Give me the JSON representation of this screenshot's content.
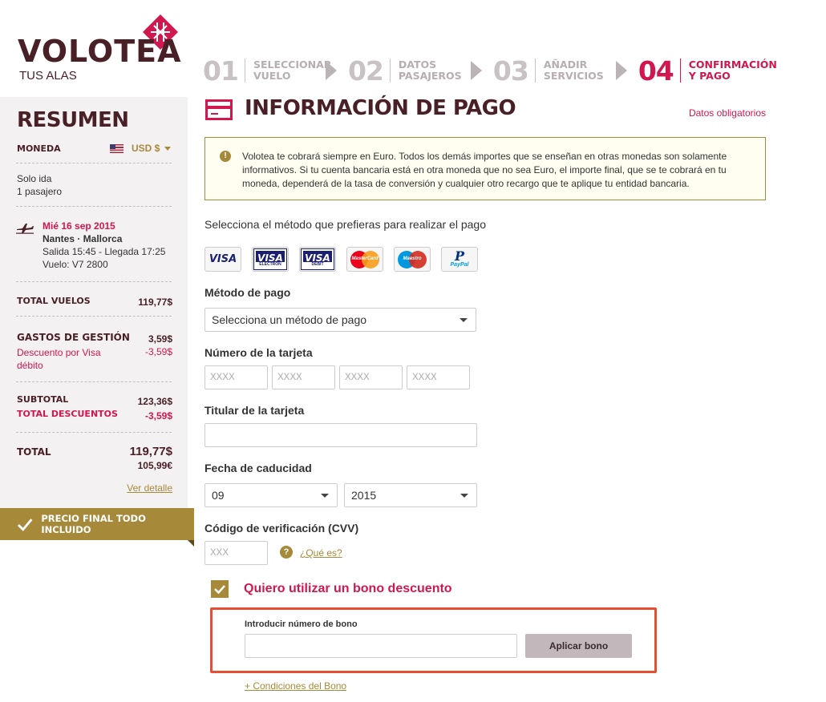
{
  "brand": {
    "name": "VOLOTEA",
    "tagline": "TUS ALAS"
  },
  "steps": [
    {
      "num": "01",
      "label": "SELECCIONAR VUELO",
      "active": false
    },
    {
      "num": "02",
      "label": "DATOS PASAJEROS",
      "active": false
    },
    {
      "num": "03",
      "label": "AÑADIR SERVICIOS",
      "active": false
    },
    {
      "num": "04",
      "label": "CONFIRMACIÓN Y PAGO",
      "active": true
    }
  ],
  "summary": {
    "title": "RESUMEN",
    "currency_label": "MONEDA",
    "currency_value": "USD $",
    "trip_type": "Solo ida",
    "passengers": "1 pasajero",
    "flight": {
      "date": "Mié 16 sep 2015",
      "route": "Nantes · Mallorca",
      "times": "Salida 15:45 - Llegada 17:25",
      "flight_no": "Vuelo: V7 2800"
    },
    "total_flights_label": "TOTAL VUELOS",
    "total_flights_value": "119,77$",
    "fees_label": "GASTOS DE GESTIÓN",
    "fees_value": "3,59$",
    "discount_label": "Descuento por Visa débito",
    "discount_value": "-3,59$",
    "subtotal_label": "SUBTOTAL",
    "subtotal_value": "123,36$",
    "total_discounts_label": "TOTAL DESCUENTOS",
    "total_discounts_value": "-3,59$",
    "total_label": "TOTAL",
    "total_value": "119,77$",
    "total_eur": "105,99€",
    "detail_link": "Ver detalle",
    "final_banner": "PRECIO FINAL TODO INCLUIDO"
  },
  "payment": {
    "title": "INFORMACIÓN DE PAGO",
    "required_note": "Datos obligatorios",
    "info": "Volotea te cobrará siempre en Euro. Todos los demás importes que se enseñan en otras monedas son solamente informativos. Si tu cuenta bancaria está en otra moneda que no sea Euro, el importe final, que se te cobrará en tu moneda, dependerá de la tasa de conversión y cualquier otro recargo que te aplique tu entidad bancaria.",
    "choose_method": "Selecciona el método que prefieras para realizar el pago",
    "cards": [
      "VISA",
      "VISA ELECTRON",
      "VISA DEBIT",
      "MasterCard",
      "Maestro",
      "PayPal"
    ],
    "method_label": "Método de pago",
    "method_value": "Selecciona un método de pago",
    "card_number_label": "Número de la tarjeta",
    "card_number_placeholder": "XXXX",
    "holder_label": "Titular de la tarjeta",
    "expiry_label": "Fecha de caducidad",
    "expiry_month": "09",
    "expiry_year": "2015",
    "cvv_label": "Código de verificación (CVV)",
    "cvv_placeholder": "XXX",
    "cvv_help": "¿Qué es?",
    "voucher_checkbox_label": "Quiero utilizar un bono descuento",
    "voucher_field_label": "Introducir número de bono",
    "voucher_button": "Aplicar bono",
    "voucher_conditions": "+ Condiciones del Bono"
  },
  "colors": {
    "brand": "#4a2027",
    "accent": "#d1174f",
    "gold": "#a7893a",
    "highlight": "#e44f31"
  }
}
